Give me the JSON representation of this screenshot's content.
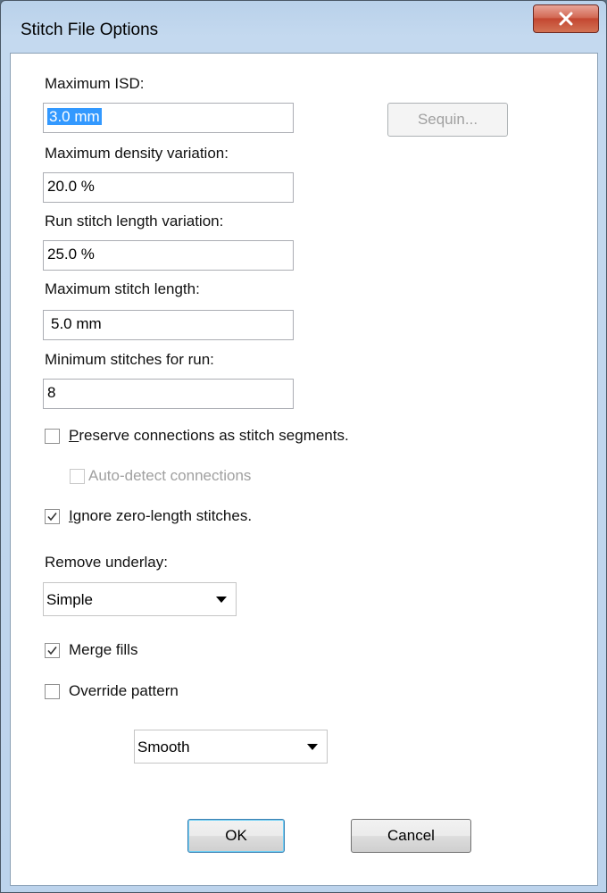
{
  "window": {
    "title": "Stitch File Options"
  },
  "fields": {
    "max_isd_label": "Maximum ISD:",
    "max_isd_value": "3.0 mm",
    "sequin_button": "Sequin...",
    "max_density_label": "Maximum density variation:",
    "max_density_value": "20.0 %",
    "run_length_label": "Run stitch length variation:",
    "run_length_value": "25.0 %",
    "max_stitch_label": "Maximum stitch length:",
    "max_stitch_value": "5.0 mm",
    "min_run_label": "Minimum stitches for run:",
    "min_run_value": "8"
  },
  "checkboxes": {
    "preserve_label_accel": "P",
    "preserve_label_rest": "reserve connections as stitch segments.",
    "preserve_checked": false,
    "autodetect_label": "Auto-detect connections",
    "autodetect_checked": false,
    "autodetect_enabled": false,
    "ignore_label_accel": "I",
    "ignore_label_rest": "gnore zero-length stitches.",
    "ignore_checked": true,
    "merge_label": "Merge fills",
    "merge_checked": true,
    "override_label": "Override pattern",
    "override_checked": false
  },
  "underlay": {
    "label": "Remove underlay:",
    "selected": "Simple"
  },
  "pattern": {
    "selected": "Smooth"
  },
  "buttons": {
    "ok": "OK",
    "cancel": "Cancel"
  }
}
